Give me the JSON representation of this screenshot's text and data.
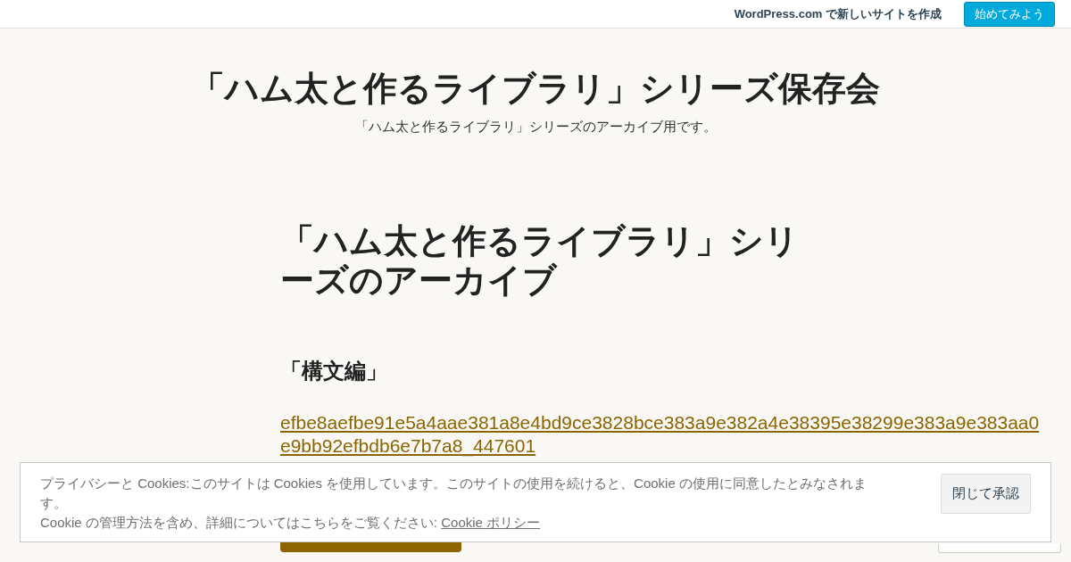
{
  "top_bar": {
    "promo": "WordPress.com で新しいサイトを作成",
    "button": "始めてみよう"
  },
  "site": {
    "title": "「ハム太と作るライブラリ」シリーズ保存会",
    "tagline": "「ハム太と作るライブラリ」シリーズのアーカイブ用です。"
  },
  "post": {
    "title": "「ハム太と作るライブラリ」シリーズのアーカイブ",
    "heading": "「構文編」",
    "links": [
      "efbe8aefbe91e5a4aae381a8e4bd9ce3828bce383a9e382a4e38395e38299e383a9e383aa0",
      "e9bb92efbdb6e7b7a8_447601"
    ]
  },
  "cookie_banner": {
    "text": "プライバシーと Cookies:このサイトは Cookies を使用しています。このサイトの使用を続けると、Cookie の使用に同意したとみなされます。",
    "text2": "Cookie の管理方法を含め、詳細についてはこちらをご覧ください: ",
    "link": "Cookie ポリシー",
    "button": "閉じて承認"
  }
}
